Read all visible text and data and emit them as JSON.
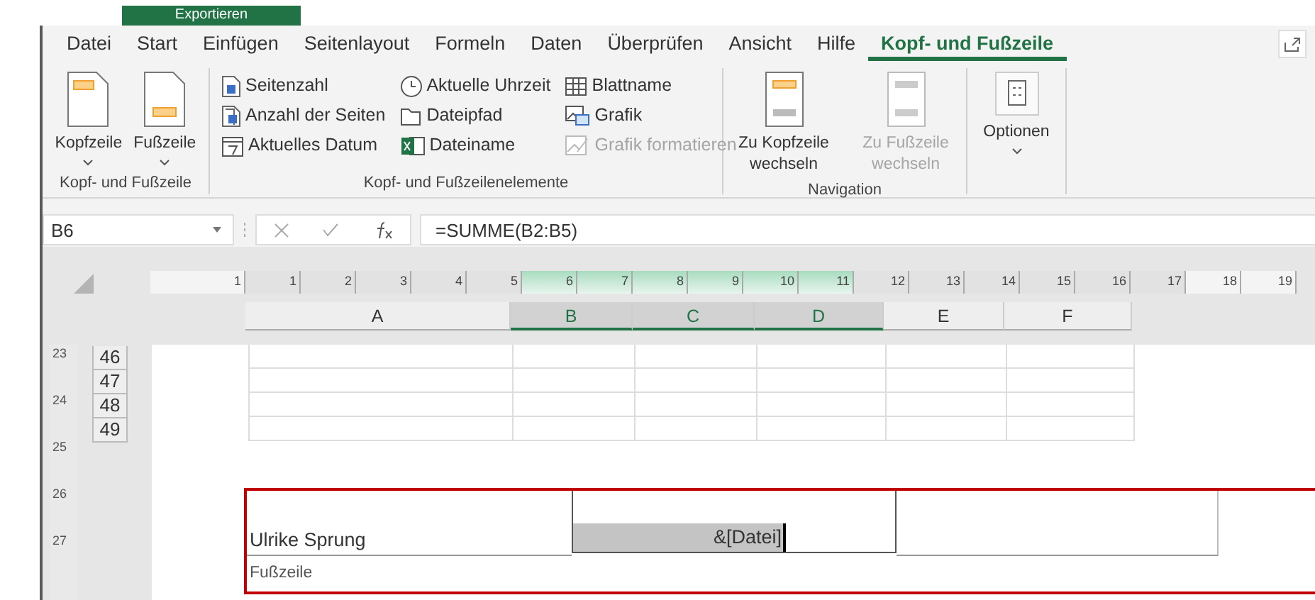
{
  "backstage": {
    "export_button": "Exportieren"
  },
  "tabs": [
    {
      "label": "Datei",
      "selected": false
    },
    {
      "label": "Start",
      "selected": false
    },
    {
      "label": "Einfügen",
      "selected": false
    },
    {
      "label": "Seitenlayout",
      "selected": false
    },
    {
      "label": "Formeln",
      "selected": false
    },
    {
      "label": "Daten",
      "selected": false
    },
    {
      "label": "Überprüfen",
      "selected": false
    },
    {
      "label": "Ansicht",
      "selected": false
    },
    {
      "label": "Hilfe",
      "selected": false
    },
    {
      "label": "Kopf- und Fußzeile",
      "selected": true
    }
  ],
  "ribbon": {
    "groups": [
      {
        "kind": "large",
        "label": "Kopf- und Fußzeile",
        "buttons": [
          {
            "label": "Kopfzeile",
            "dropdown": true,
            "disabled": false
          },
          {
            "label": "Fußzeile",
            "dropdown": true,
            "disabled": false
          }
        ]
      },
      {
        "kind": "small",
        "label": "Kopf- und Fußzeilenelemente",
        "buttons": [
          {
            "label": "Seitenzahl",
            "disabled": false
          },
          {
            "label": "Anzahl der Seiten",
            "disabled": false
          },
          {
            "label": "Aktuelles Datum",
            "disabled": false
          },
          {
            "label": "Aktuelle Uhrzeit",
            "disabled": false
          },
          {
            "label": "Dateipfad",
            "disabled": false
          },
          {
            "label": "Dateiname",
            "disabled": false
          },
          {
            "label": "Blattname",
            "disabled": false
          },
          {
            "label": "Grafik",
            "disabled": false
          },
          {
            "label": "Grafik formatieren",
            "disabled": true
          }
        ]
      },
      {
        "kind": "large",
        "label": "Navigation",
        "buttons": [
          {
            "label": "Zu Kopfzeile wechseln",
            "dropdown": false,
            "disabled": false
          },
          {
            "label": "Zu Fußzeile wechseln",
            "dropdown": false,
            "disabled": true
          }
        ]
      },
      {
        "kind": "large",
        "buttons": [
          {
            "label": "Optionen",
            "dropdown": true,
            "disabled": false
          }
        ]
      }
    ]
  },
  "formula_bar": {
    "name_box": "B6",
    "formula": "=SUMME(B2:B5)"
  },
  "ruler": [
    {
      "label": "1",
      "selected": false
    },
    {
      "label": "1",
      "selected": false
    },
    {
      "label": "2",
      "selected": false
    },
    {
      "label": "3",
      "selected": false
    },
    {
      "label": "4",
      "selected": false
    },
    {
      "label": "5",
      "selected": false
    },
    {
      "label": "6",
      "selected": true
    },
    {
      "label": "7",
      "selected": true
    },
    {
      "label": "8",
      "selected": true
    },
    {
      "label": "9",
      "selected": true
    },
    {
      "label": "10",
      "selected": true
    },
    {
      "label": "11",
      "selected": true
    },
    {
      "label": "12",
      "selected": false
    },
    {
      "label": "13",
      "selected": false
    },
    {
      "label": "14",
      "selected": false
    },
    {
      "label": "15",
      "selected": false
    },
    {
      "label": "16",
      "selected": false
    },
    {
      "label": "17",
      "selected": false
    },
    {
      "label": "18",
      "selected": false
    },
    {
      "label": "19",
      "selected": false
    }
  ],
  "vertical_ruler": [
    "23",
    "24",
    "25",
    "26",
    "27"
  ],
  "columns": [
    {
      "label": "A",
      "selected": false
    },
    {
      "label": "B",
      "selected": true
    },
    {
      "label": "C",
      "selected": true
    },
    {
      "label": "D",
      "selected": true
    },
    {
      "label": "E",
      "selected": false
    },
    {
      "label": "F",
      "selected": false
    }
  ],
  "rows": [
    "46",
    "47",
    "48",
    "49"
  ],
  "footer": {
    "left": "Ulrike Sprung",
    "center": "&[Datei]",
    "label": "Fußzeile"
  }
}
